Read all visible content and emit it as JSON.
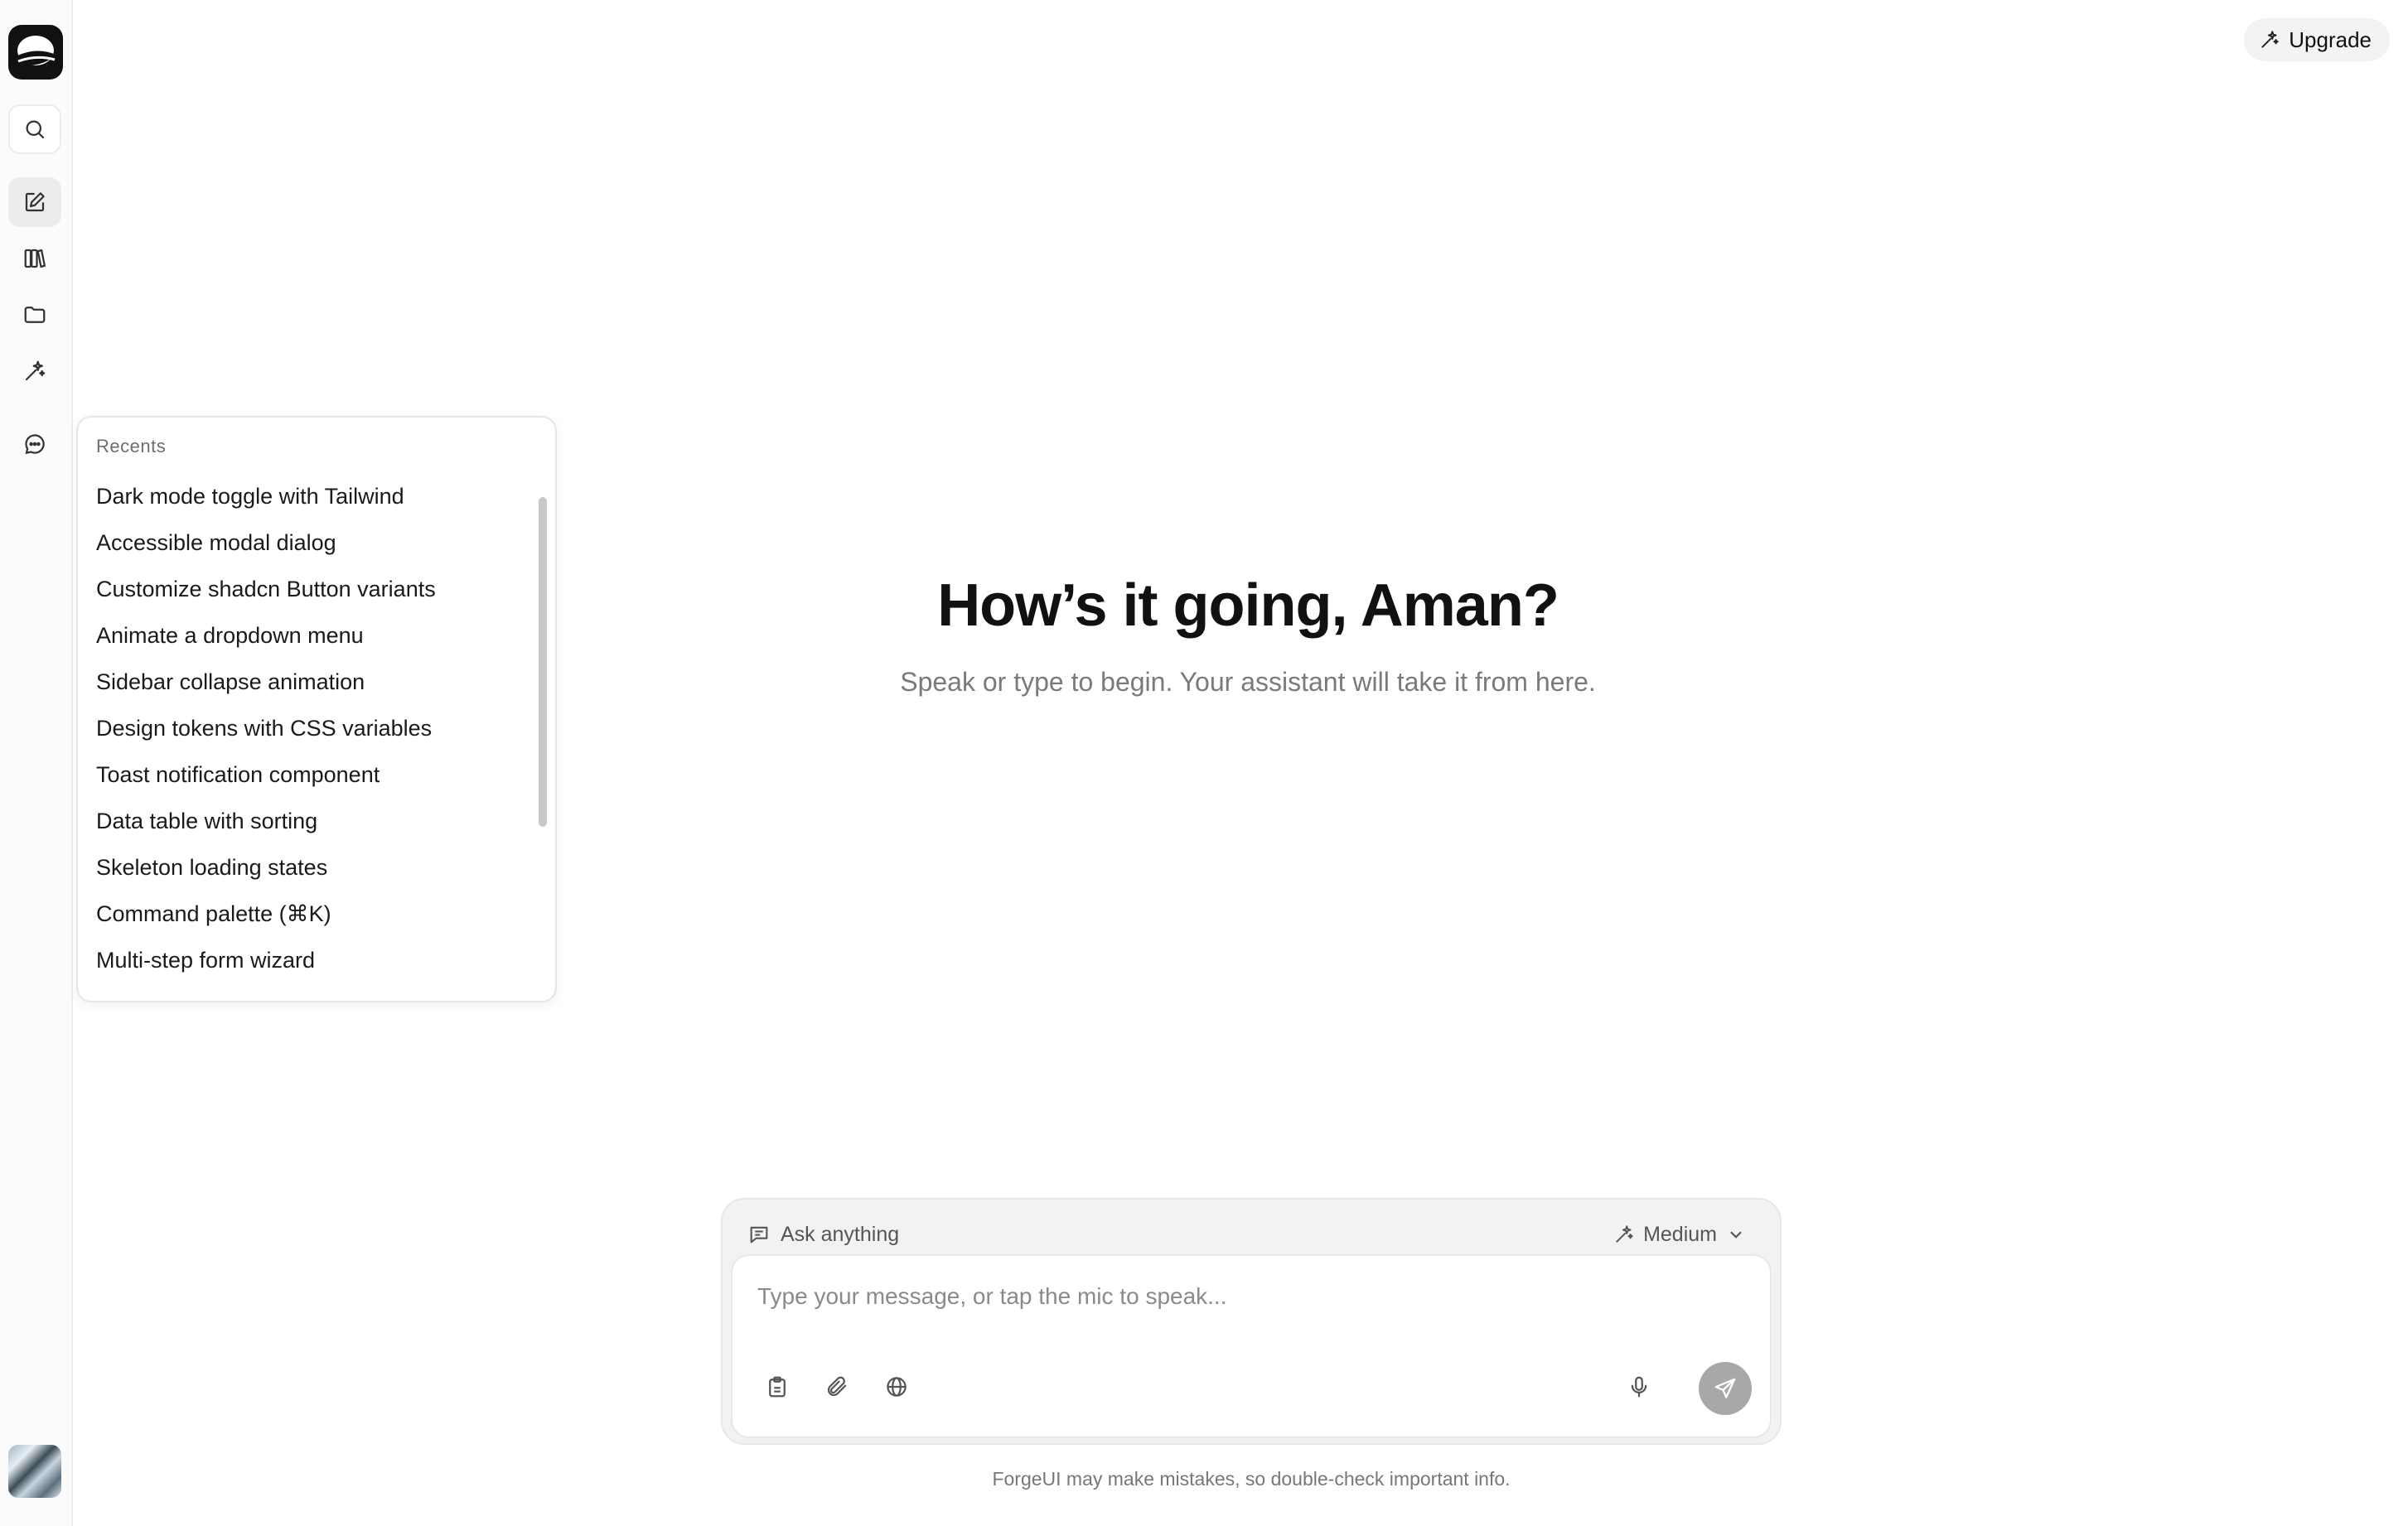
{
  "header": {
    "upgrade_label": "Upgrade"
  },
  "sidebar": {
    "icons": [
      "logo",
      "search-icon",
      "new-chat-icon",
      "library-icon",
      "folder-icon",
      "sparkle-icon",
      "chat-icon"
    ]
  },
  "recents": {
    "title": "Recents",
    "items": [
      "Dark mode toggle with Tailwind",
      "Accessible modal dialog",
      "Customize shadcn Button variants",
      "Animate a dropdown menu",
      "Sidebar collapse animation",
      "Design tokens with CSS variables",
      "Toast notification component",
      "Data table with sorting",
      "Skeleton loading states",
      "Command palette (⌘K)",
      "Multi-step form wizard"
    ]
  },
  "hero": {
    "title": "How’s it going, Aman?",
    "subtitle": "Speak or type to begin. Your assistant will take it from here."
  },
  "composer": {
    "mode_label": "Ask anything",
    "model_label": "Medium",
    "input_value": "",
    "placeholder": "Type your message, or tap the mic to speak..."
  },
  "footer": {
    "disclaimer": "ForgeUI may make mistakes, so double-check important info."
  },
  "colors": {
    "accent": "#111111",
    "send_disabled": "#a8a8a8",
    "panel_bg": "#f2f2f2"
  }
}
